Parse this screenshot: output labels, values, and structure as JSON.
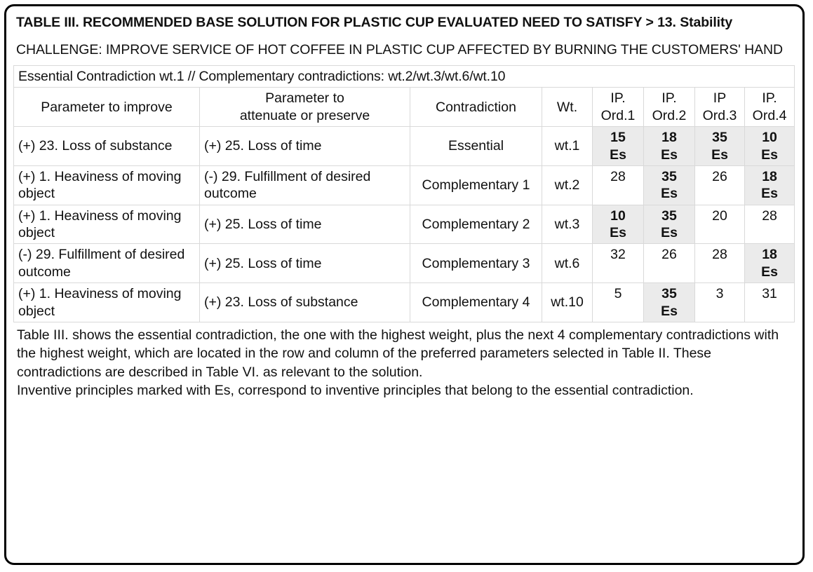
{
  "header": {
    "title": "TABLE III. RECOMMENDED BASE SOLUTION FOR PLASTIC CUP EVALUATED NEED TO SATISFY > 13. Stability",
    "subtitle": "CHALLENGE: IMPROVE SERVICE OF HOT COFFEE IN PLASTIC CUP AFFECTED BY BURNING THE CUSTOMERS' HAND"
  },
  "table": {
    "banner": "Essential Contradiction wt.1 // Complementary contradictions: wt.2/wt.3/wt.6/wt.10",
    "columns": [
      {
        "label": "Parameter to improve"
      },
      {
        "label_line1": "Parameter to",
        "label_line2": "attenuate or preserve"
      },
      {
        "label": "Contradiction"
      },
      {
        "label": "Wt."
      },
      {
        "label_line1": "IP.",
        "label_line2": "Ord.1"
      },
      {
        "label_line1": "IP.",
        "label_line2": "Ord.2"
      },
      {
        "label_line1": "IP",
        "label_line2": "Ord.3"
      },
      {
        "label_line1": "IP.",
        "label_line2": "Ord.4"
      }
    ],
    "rows": [
      {
        "improve": "(+) 23. Loss of substance",
        "attenuate": "(+) 25. Loss of time",
        "contradiction": "Essential",
        "wt": "wt.1",
        "ip": [
          {
            "value": "15",
            "es": "Es",
            "shaded": true
          },
          {
            "value": "18",
            "es": "Es",
            "shaded": true
          },
          {
            "value": "35",
            "es": "Es",
            "shaded": true
          },
          {
            "value": "10",
            "es": "Es",
            "shaded": true
          }
        ]
      },
      {
        "improve": "(+) 1. Heaviness of moving object",
        "attenuate": "(-) 29. Fulfillment of desired outcome",
        "contradiction": "Complementary 1",
        "wt": "wt.2",
        "ip": [
          {
            "value": "28",
            "es": "",
            "shaded": false
          },
          {
            "value": "35",
            "es": "Es",
            "shaded": true
          },
          {
            "value": "26",
            "es": "",
            "shaded": false
          },
          {
            "value": "18",
            "es": "Es",
            "shaded": true
          }
        ]
      },
      {
        "improve": "(+) 1. Heaviness of moving object",
        "attenuate": "(+) 25. Loss of time",
        "contradiction": "Complementary 2",
        "wt": "wt.3",
        "ip": [
          {
            "value": "10",
            "es": "Es",
            "shaded": true
          },
          {
            "value": "35",
            "es": "Es",
            "shaded": true
          },
          {
            "value": "20",
            "es": "",
            "shaded": false
          },
          {
            "value": "28",
            "es": "",
            "shaded": false
          }
        ]
      },
      {
        "improve": "(-) 29. Fulfillment of desired outcome",
        "attenuate": "(+) 25. Loss of time",
        "contradiction": "Complementary 3",
        "wt": "wt.6",
        "ip": [
          {
            "value": "32",
            "es": "",
            "shaded": false
          },
          {
            "value": "26",
            "es": "",
            "shaded": false
          },
          {
            "value": "28",
            "es": "",
            "shaded": false
          },
          {
            "value": "18",
            "es": "Es",
            "shaded": true
          }
        ]
      },
      {
        "improve": "(+) 1. Heaviness of moving object",
        "attenuate": "(+) 23. Loss of substance",
        "contradiction": "Complementary 4",
        "wt": "wt.10",
        "ip": [
          {
            "value": "5",
            "es": "",
            "shaded": false
          },
          {
            "value": "35",
            "es": "Es",
            "shaded": true
          },
          {
            "value": "3",
            "es": "",
            "shaded": false
          },
          {
            "value": "31",
            "es": "",
            "shaded": false
          }
        ]
      }
    ]
  },
  "note": {
    "paragraph1": "Table III. shows the essential contradiction, the one with the highest weight, plus the next 4 complementary contradictions with the highest weight, which are located in the row and column of the preferred parameters selected in Table II. These contradictions are described in Table VI. as relevant to the solution.",
    "paragraph2": "Inventive principles marked with Es, correspond to inventive principles that belong to the essential contradiction."
  },
  "colors": {
    "frame_border": "#000000",
    "grid_line": "#d9d9d9",
    "shaded_cell": "#ebebeb",
    "text": "#111111",
    "page_background": "#ffffff"
  }
}
